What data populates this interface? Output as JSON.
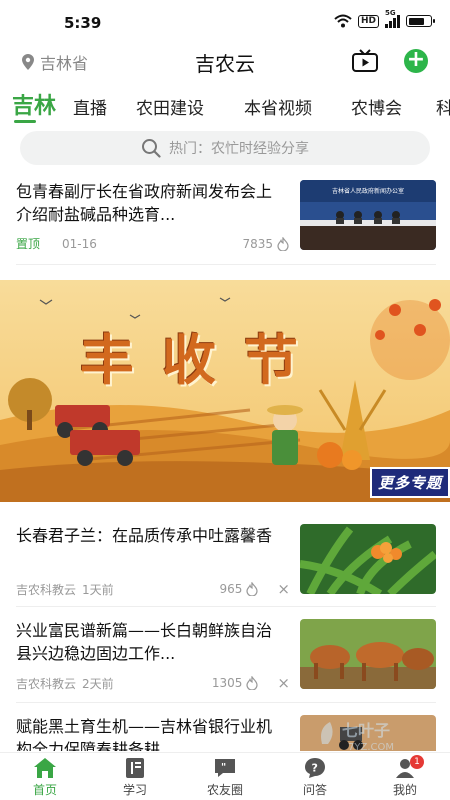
{
  "status": {
    "time": "5:39",
    "network": "5G",
    "hd": "HD",
    "battery_level": 0.75
  },
  "header": {
    "location": "吉林省",
    "title": "吉农云"
  },
  "tabs": [
    "吉林",
    "直播",
    "农田建设",
    "本省视频",
    "农博会",
    "科"
  ],
  "search": {
    "placeholder": "热门：农忙时经验分享"
  },
  "news_top": {
    "title": "包青春副厅长在省政府新闻发布会上介绍耐盐碱品种选育...",
    "tag": "置顶",
    "date": "01-16",
    "likes": "7835",
    "thumb_caption": "吉林省人民政府新闻办公室"
  },
  "banner": {
    "title": "丰收节",
    "button": "更多专题"
  },
  "news": [
    {
      "title": "长春君子兰：在品质传承中吐露馨香",
      "source": "吉农科教云",
      "time": "1天前",
      "likes": "965"
    },
    {
      "title": "兴业富民谱新篇——长白朝鲜族自治县兴边稳边固边工作...",
      "source": "吉农科教云",
      "time": "2天前",
      "likes": "1305"
    },
    {
      "title": "赋能黑土育生机——吉林省银行业机构全力保障春耕备耕..."
    }
  ],
  "bottom_nav": [
    {
      "label": "首页",
      "icon": "home-icon"
    },
    {
      "label": "学习",
      "icon": "book-icon"
    },
    {
      "label": "农友圈",
      "icon": "chat-quote-icon"
    },
    {
      "label": "问答",
      "icon": "question-icon"
    },
    {
      "label": "我的",
      "icon": "person-icon",
      "badge": "1"
    }
  ],
  "watermark": "七叶子 7YZ.COM",
  "colors": {
    "accent": "#3aa645",
    "add_button": "#2db54a",
    "banner_bg": "#f3c46b",
    "banner_title": "#d2691e",
    "badge": "#e53935"
  }
}
